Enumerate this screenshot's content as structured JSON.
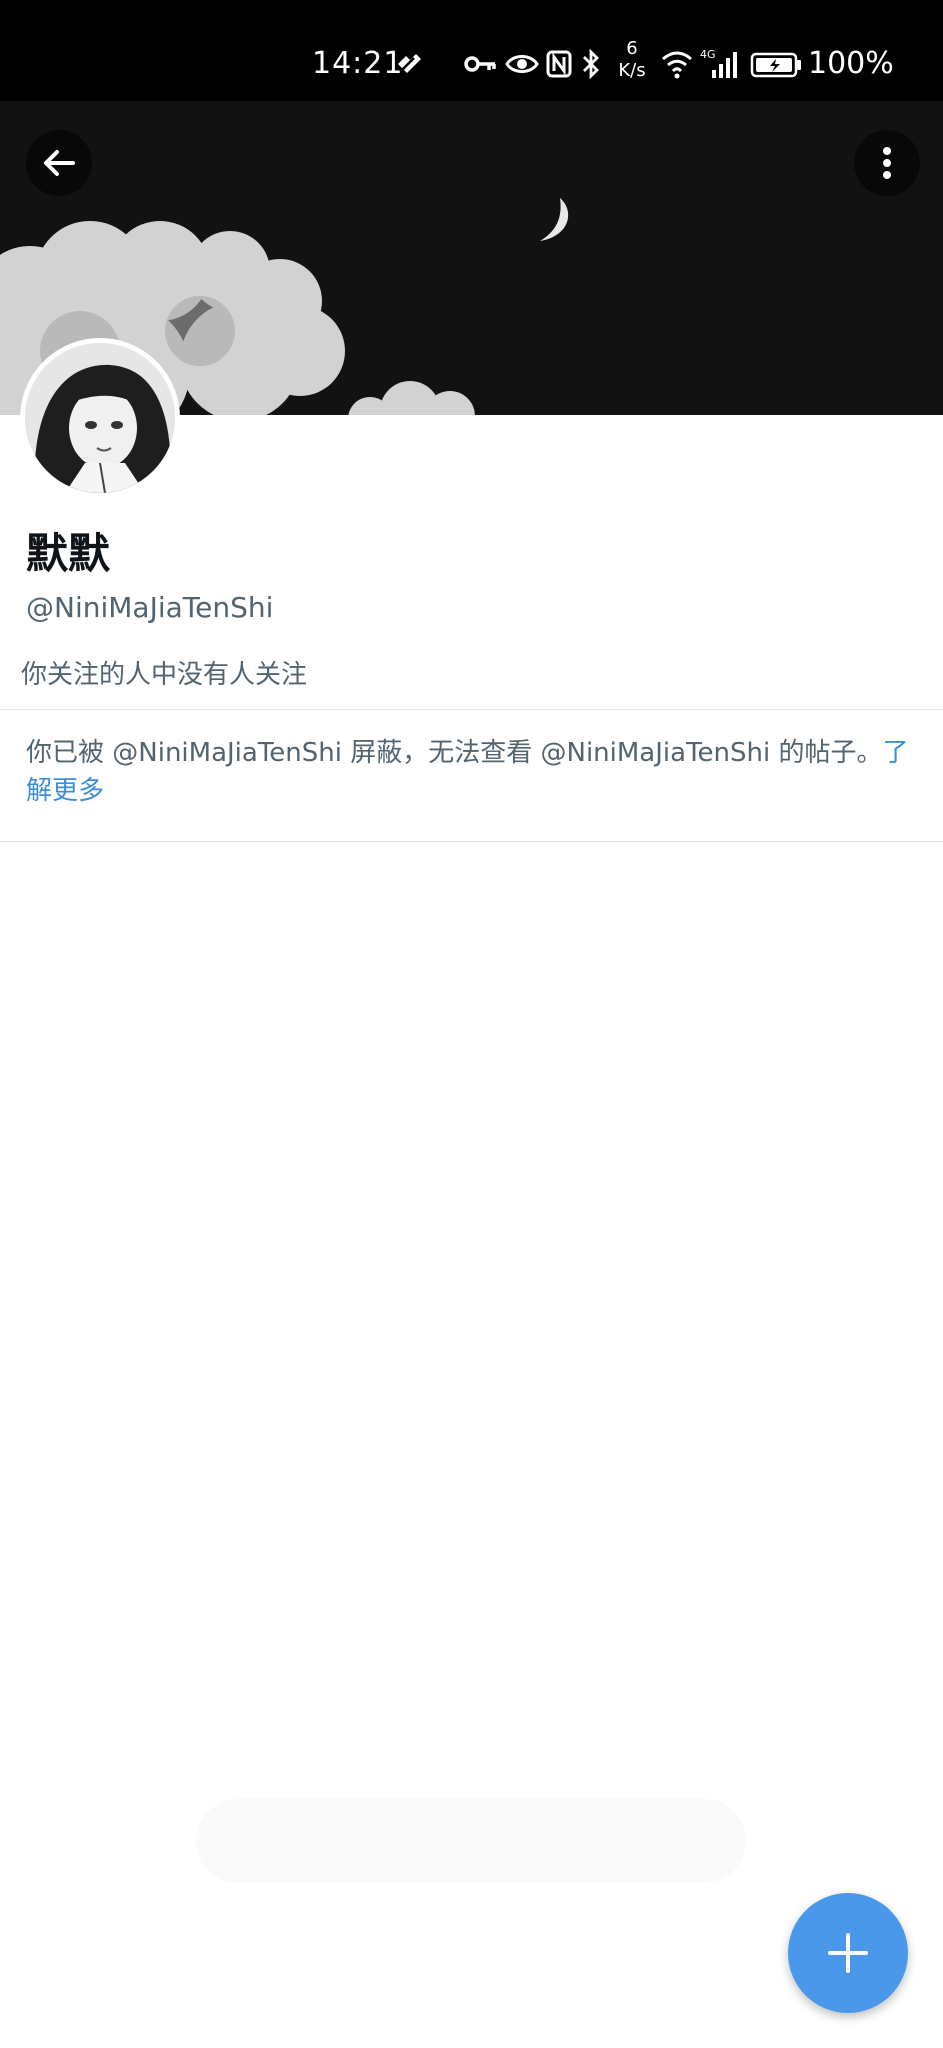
{
  "status_bar": {
    "time": "14:21",
    "net_speed_value": "6",
    "net_speed_unit": "K/s",
    "network_type": "4G",
    "battery": "100%",
    "icons": [
      "heart-sync-icon",
      "key-icon",
      "eye-icon",
      "nfc-icon",
      "bluetooth-icon",
      "wifi-icon",
      "signal-icon",
      "battery-icon"
    ]
  },
  "header": {
    "back_icon": "arrow-left-icon",
    "more_icon": "more-vertical-icon"
  },
  "profile": {
    "display_name": "默默",
    "handle": "@NiniMaJiaTenShi",
    "followers_note": "你关注的人中没有人关注",
    "blocked_text": "你已被 @NiniMaJiaTenShi 屏蔽，无法查看 @NiniMaJiaTenShi 的帖子。",
    "learn_more": "了解更多"
  },
  "fab": {
    "icon": "plus-icon"
  },
  "colors": {
    "accent": "#4a98ea",
    "link": "#3b8fd6",
    "secondary_text": "#536471",
    "banner_bg": "#121212"
  }
}
